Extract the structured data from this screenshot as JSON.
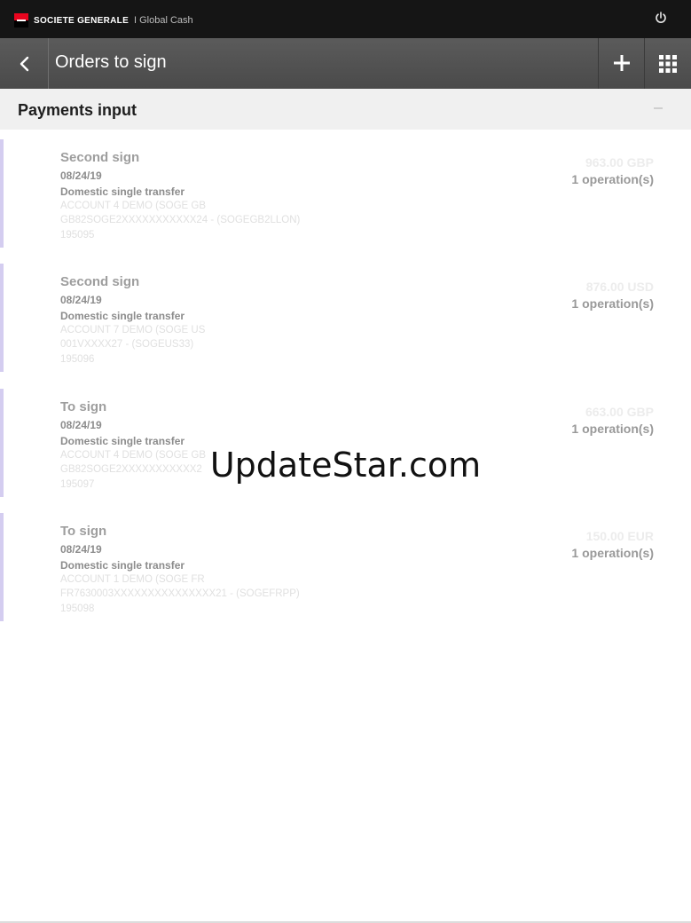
{
  "topbar": {
    "brand": "SOCIETE GENERALE",
    "separator": "I",
    "product": "Global Cash",
    "power_icon": "power-icon"
  },
  "header": {
    "title": "Orders to sign",
    "back_icon": "chevron-left-icon",
    "add_icon": "plus-icon",
    "apps_icon": "grid-icon"
  },
  "section": {
    "title": "Payments input",
    "collapse_icon": "minus-icon"
  },
  "orders": [
    {
      "status": "Second sign",
      "date": "08/24/19",
      "type": "Domestic single transfer",
      "account": "ACCOUNT 4 DEMO (SOGE GB",
      "iban": "GB82SOGE2XXXXXXXXXXX24 - (SOGEGB2LLON)",
      "reference": "195095",
      "amount": "963.00 GBP",
      "operations": "1 operation(s)"
    },
    {
      "status": "Second sign",
      "date": "08/24/19",
      "type": "Domestic single transfer",
      "account": "ACCOUNT 7 DEMO (SOGE US",
      "iban": "001VXXXX27 - (SOGEUS33)",
      "reference": "195096",
      "amount": "876.00 USD",
      "operations": "1 operation(s)"
    },
    {
      "status": "To sign",
      "date": "08/24/19",
      "type": "Domestic single transfer",
      "account": "ACCOUNT 4 DEMO (SOGE GB",
      "iban": "GB82SOGE2XXXXXXXXXXX2",
      "reference": "195097",
      "amount": "663.00 GBP",
      "operations": "1 operation(s)"
    },
    {
      "status": "To sign",
      "date": "08/24/19",
      "type": "Domestic single transfer",
      "account": "ACCOUNT 1 DEMO (SOGE FR",
      "iban": "FR7630003XXXXXXXXXXXXXXX21 - (SOGEFRPP)",
      "reference": "195098",
      "amount": "150.00 EUR",
      "operations": "1 operation(s)"
    }
  ],
  "watermark": "UpdateStar.com",
  "colors": {
    "topbar_bg": "#151515",
    "navbar_bg": "#4f4f4f",
    "brand_red": "#e9041e",
    "accent": "#d4cdf0",
    "section_bg": "#f0f0f0"
  }
}
